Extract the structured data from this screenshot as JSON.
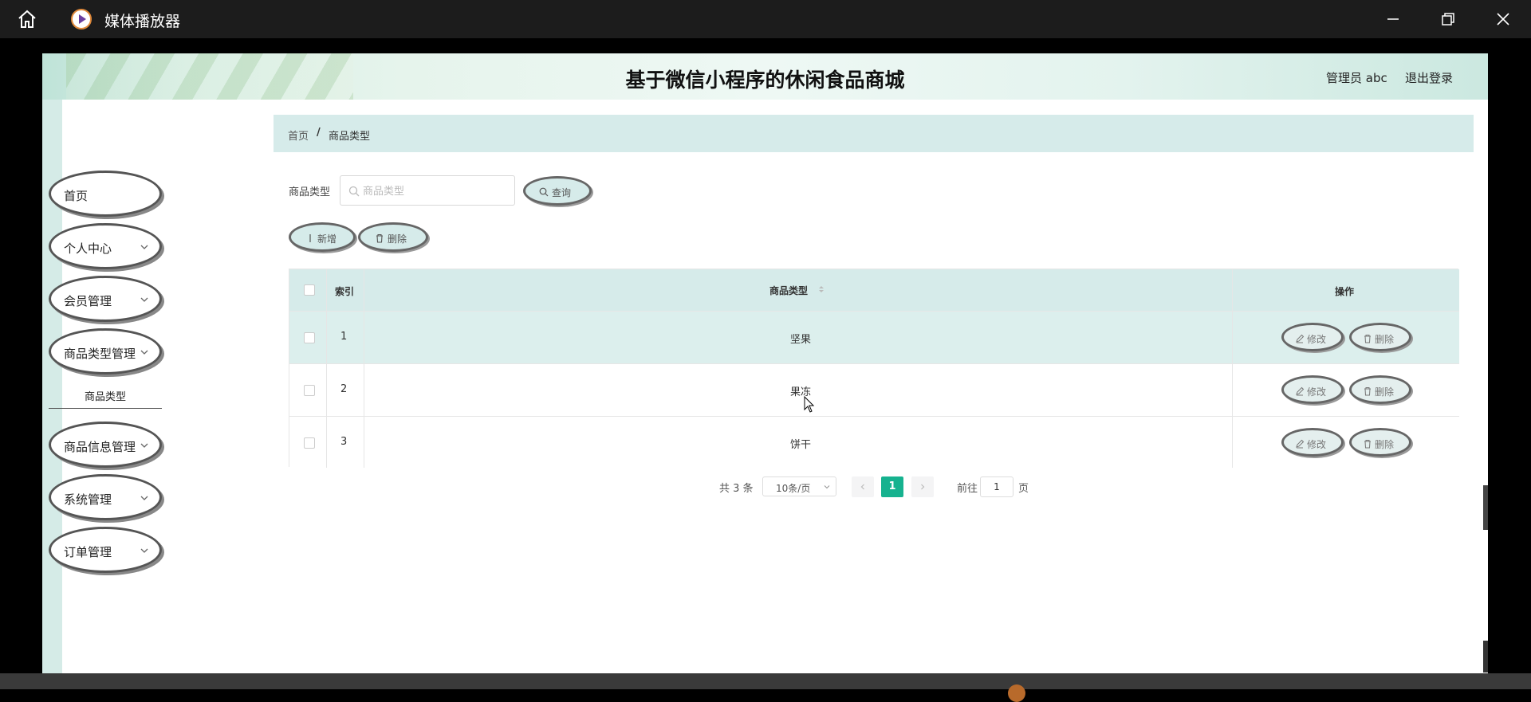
{
  "window": {
    "title": "媒体播放器"
  },
  "header": {
    "site_title": "基于微信小程序的休闲食品商城",
    "admin": "管理员 abc",
    "logout": "退出登录"
  },
  "sidebar": {
    "items": [
      {
        "label": "首页"
      },
      {
        "label": "个人中心"
      },
      {
        "label": "会员管理"
      },
      {
        "label": "商品类型管理"
      },
      {
        "label": "商品信息管理"
      },
      {
        "label": "系统管理"
      },
      {
        "label": "订单管理"
      }
    ],
    "sub_item": "商品类型"
  },
  "breadcrumb": {
    "home": "首页",
    "separator": "/",
    "current": "商品类型"
  },
  "search": {
    "label": "商品类型",
    "placeholder": "商品类型",
    "query_button": "查询"
  },
  "toolbar": {
    "add_button": "新增",
    "delete_button": "删除"
  },
  "table": {
    "headers": {
      "index": "索引",
      "type": "商品类型",
      "actions": "操作"
    },
    "rows": [
      {
        "index": "1",
        "type": "坚果"
      },
      {
        "index": "2",
        "type": "果冻"
      },
      {
        "index": "3",
        "type": "饼干"
      }
    ],
    "edit_label": "修改",
    "delete_label": "删除"
  },
  "pagination": {
    "total": "共 3 条",
    "page_size": "10条/页",
    "current_page": "1",
    "goto_label": "前往",
    "goto_value": "1",
    "page_suffix": "页"
  },
  "colors": {
    "accent": "#16b28f",
    "header_bg": "#d6ebea"
  }
}
